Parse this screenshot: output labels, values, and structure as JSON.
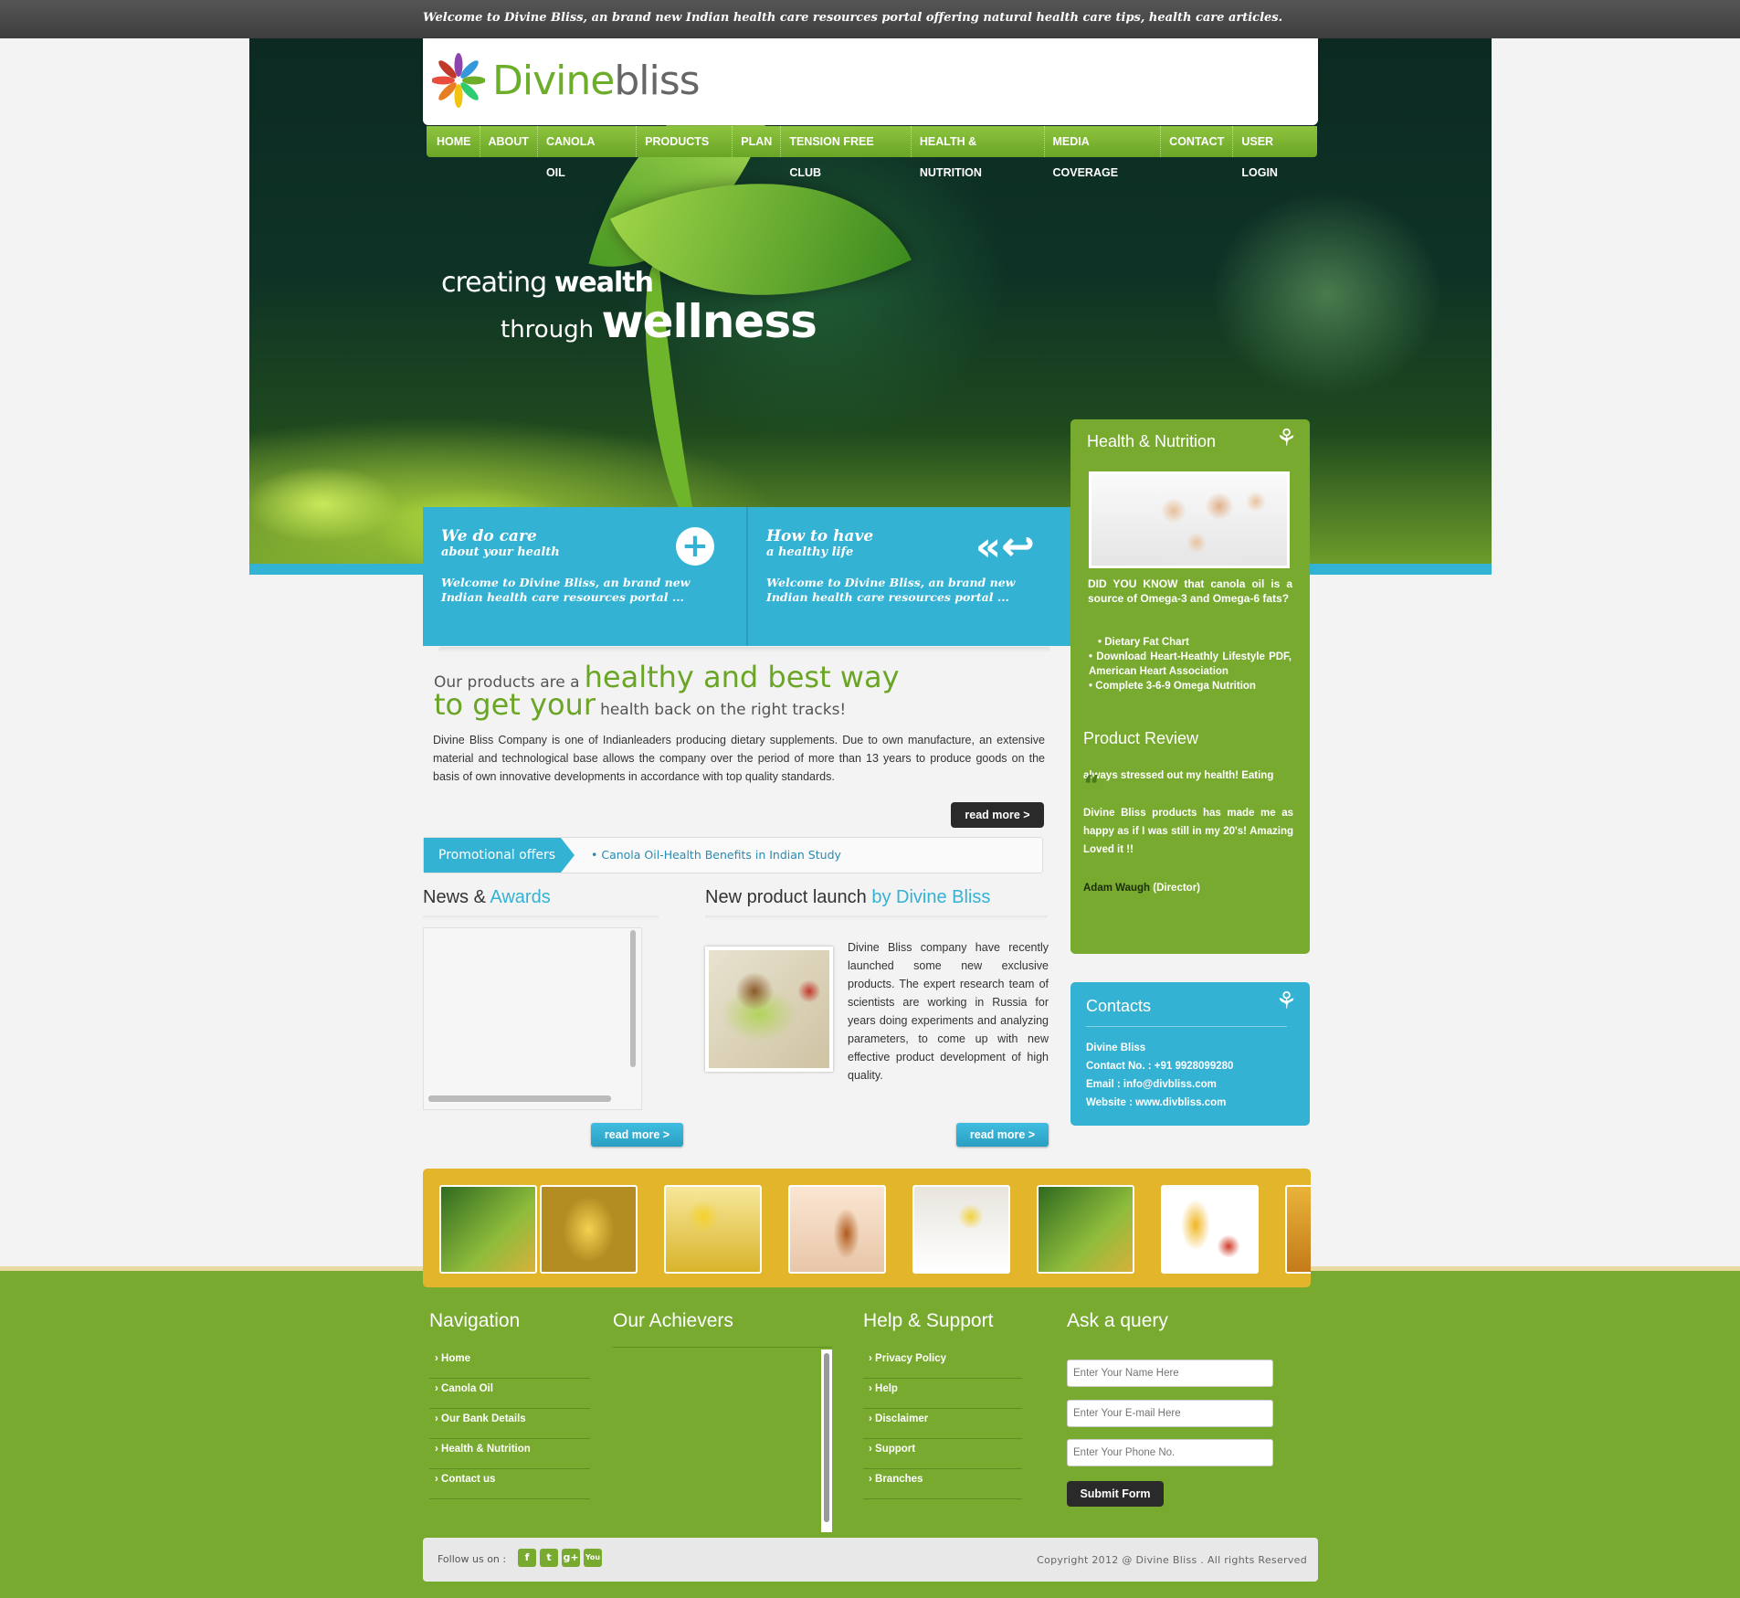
{
  "topbar": {
    "welcome": "Welcome to Divine Bliss, an brand new Indian health care resources portal offering natural health care tips, health care articles."
  },
  "logo": {
    "part1": "Divine",
    "part2": "bliss",
    "icon": "flower-icon"
  },
  "nav": [
    "HOME",
    "ABOUT",
    "CANOLA OIL",
    "PRODUCTS",
    "PLAN",
    "TENSION FREE CLUB",
    "HEALTH & NUTRITION",
    "MEDIA COVERAGE",
    "CONTACT",
    "USER LOGIN"
  ],
  "hero": {
    "l1a": "creating",
    "l1b": "wealth",
    "l2a": "through",
    "l2b": "wellness"
  },
  "blue": {
    "c1": {
      "h1": "We do care",
      "h2": "about your health",
      "p": "Welcome to Divine Bliss, an brand new Indian health care resources portal ...",
      "icon": "plus-circle-icon"
    },
    "c2": {
      "h1": "How to have",
      "h2": "a healthy life",
      "p": "Welcome to Divine Bliss, an brand new Indian health care resources portal ...",
      "icon": "back-arrows-icon"
    }
  },
  "intro": {
    "s1": "Our products are a",
    "g1": "healthy and best way",
    "g2": "to get your",
    "s2": "health back on the right tracks!",
    "text": "Divine Bliss Company is one of Indianleaders producing dietary supplements. Due to own manufacture, an extensive material and technological base allows the company over the period of more than 13 years to produce goods on the basis of own innovative developments in accordance with top quality standards.",
    "read_more": "read more >"
  },
  "promo": {
    "tag": "Promotional offers",
    "item": "• Canola Oil-Health Benefits in Indian Study"
  },
  "news": {
    "t1": "News &",
    "t2": "Awards",
    "read_more": "read more >"
  },
  "product": {
    "t1": "New product launch",
    "t2": "by Divine Bliss",
    "text": "Divine Bliss company have recently launched some new exclusive products. The expert research team of scientists are working in Russia for years doing experiments and analyzing parameters, to come up with new effective product development of high quality.",
    "read_more": "read more >"
  },
  "health": {
    "title": "Health & Nutrition",
    "did": "DID YOU KNOW that canola oil is a source of Omega-3 and Omega-6 fats?",
    "items": [
      "• Dietary Fat Chart",
      "• Download Heart-Heathly Lifestyle PDF, American Heart Association",
      "• Complete 3-6-9 Omega Nutrition"
    ],
    "review_title": "Product Review",
    "review1": "always stressed out my health! Eating",
    "review2": "Divine Bliss products has made me as happy as if I was still in my 20's! Amazing Loved it !!",
    "author": "Adam Waugh",
    "role": "(Director)"
  },
  "contacts": {
    "title": "Contacts",
    "name": "Divine Bliss",
    "phone": "Contact No. : +91 9928099280",
    "email": "Email : info@divbliss.com",
    "website": "Website : www.divbliss.com"
  },
  "footer": {
    "nav_title": "Navigation",
    "nav_items": [
      "Home",
      "Canola Oil",
      "Our Bank Details",
      "Health & Nutrition",
      "Contact us"
    ],
    "ach_title": "Our Achievers",
    "help_title": "Help & Support",
    "help_items": [
      "Privacy Policy",
      "Help",
      "Disclaimer",
      "Support",
      "Branches"
    ],
    "query_title": "Ask a query",
    "name_placeholder": "Enter Your Name Here",
    "email_placeholder": "Enter Your E-mail Here",
    "phone_placeholder": "Enter Your Phone No.",
    "submit": "Submit Form",
    "follow": "Follow us on :",
    "copyright": "Copyright 2012 @ Divine Bliss . All rights Reserved"
  },
  "colors": {
    "green": "#77aa2f",
    "blue": "#34b2d4",
    "gold": "#e3b52a",
    "dark": "#2a2a2a"
  }
}
